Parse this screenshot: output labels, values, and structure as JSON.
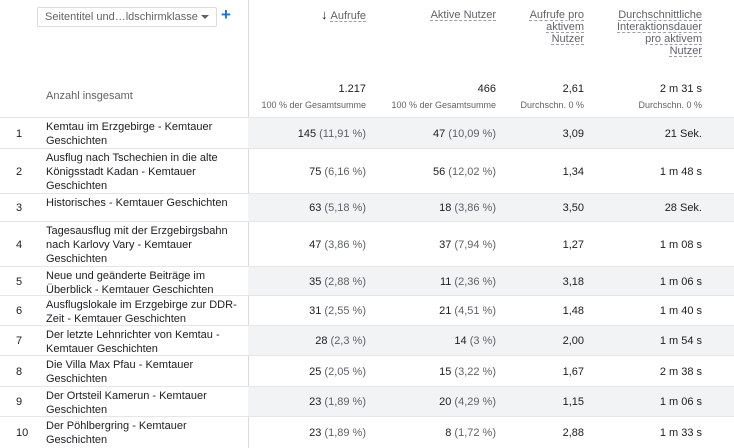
{
  "dimension_selector": {
    "label": "Seitentitel und…ldschirmklasse",
    "add_label": "+"
  },
  "columns": {
    "views": {
      "arrow": "↓",
      "label": "Aufrufe"
    },
    "active_users": {
      "label": "Aktive Nutzer"
    },
    "views_per_user": {
      "l1": "Aufrufe pro",
      "l2": "aktivem",
      "l3": "Nutzer"
    },
    "engagement": {
      "l1": "Durchschnittliche",
      "l2": "Interaktionsdauer",
      "l3": "pro aktivem",
      "l4": "Nutzer"
    }
  },
  "totals": {
    "label": "Anzahl insgesamt",
    "views": "1.217",
    "views_sub": "100 % der Gesamtsumme",
    "active_users": "466",
    "active_users_sub": "100 % der Gesamtsumme",
    "views_per_user": "2,61",
    "views_per_user_sub": "Durchschn. 0 %",
    "engagement": "2 m 31 s",
    "engagement_sub": "Durchschn. 0 %"
  },
  "rows": [
    {
      "n": "1",
      "title": "Kemtau im Erzgebirge - Kemtauer Geschichten",
      "views": "145",
      "views_pct": "(11,91 %)",
      "users": "47",
      "users_pct": "(10,09 %)",
      "vpu": "3,09",
      "eng": "21 Sek."
    },
    {
      "n": "2",
      "title": "Ausflug nach Tschechien in die alte Königsstadt Kadan - Kemtauer Geschichten",
      "views": "75",
      "views_pct": "(6,16 %)",
      "users": "56",
      "users_pct": "(12,02 %)",
      "vpu": "1,34",
      "eng": "1 m 48 s"
    },
    {
      "n": "3",
      "title": "Historisches - Kemtauer Geschichten",
      "views": "63",
      "views_pct": "(5,18 %)",
      "users": "18",
      "users_pct": "(3,86 %)",
      "vpu": "3,50",
      "eng": "28 Sek."
    },
    {
      "n": "4",
      "title": "Tagesausflug mit der Erzgebirgsbahn nach Karlovy Vary - Kemtauer Geschichten",
      "views": "47",
      "views_pct": "(3,86 %)",
      "users": "37",
      "users_pct": "(7,94 %)",
      "vpu": "1,27",
      "eng": "1 m 08 s"
    },
    {
      "n": "5",
      "title": "Neue und geänderte Beiträge im Überblick - Kemtauer Geschichten",
      "views": "35",
      "views_pct": "(2,88 %)",
      "users": "11",
      "users_pct": "(2,36 %)",
      "vpu": "3,18",
      "eng": "1 m 06 s"
    },
    {
      "n": "6",
      "title": "Ausflugslokale im Erzgebirge zur DDR-Zeit - Kemtauer Geschichten",
      "views": "31",
      "views_pct": "(2,55 %)",
      "users": "21",
      "users_pct": "(4,51 %)",
      "vpu": "1,48",
      "eng": "1 m 40 s"
    },
    {
      "n": "7",
      "title": "Der letzte Lehnrichter von Kemtau - Kemtauer Geschichten",
      "views": "28",
      "views_pct": "(2,3 %)",
      "users": "14",
      "users_pct": "(3 %)",
      "vpu": "2,00",
      "eng": "1 m 54 s"
    },
    {
      "n": "8",
      "title": "Die Villa Max Pfau - Kemtauer Geschichten",
      "views": "25",
      "views_pct": "(2,05 %)",
      "users": "15",
      "users_pct": "(3,22 %)",
      "vpu": "1,67",
      "eng": "2 m 38 s"
    },
    {
      "n": "9",
      "title": "Der Ortsteil Kamerun - Kemtauer Geschichten",
      "views": "23",
      "views_pct": "(1,89 %)",
      "users": "20",
      "users_pct": "(4,29 %)",
      "vpu": "1,15",
      "eng": "1 m 06 s"
    },
    {
      "n": "10",
      "title": "Der Pöhlbergring - Kemtauer Geschichten",
      "views": "23",
      "views_pct": "(1,89 %)",
      "users": "8",
      "users_pct": "(1,72 %)",
      "vpu": "2,88",
      "eng": "1 m 33 s"
    }
  ]
}
